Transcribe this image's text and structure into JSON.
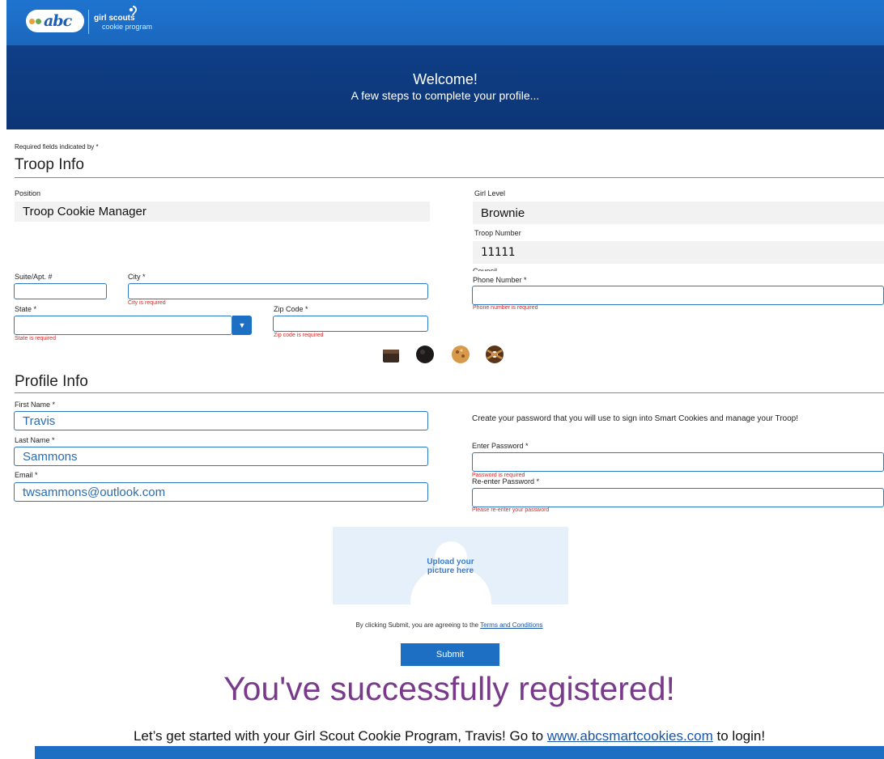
{
  "brand": {
    "abc_logo": "abc",
    "gs_line1": "girl scouts",
    "gs_line2": "cookie program"
  },
  "hero": {
    "title": "Welcome!",
    "subtitle": "A few steps to complete your profile..."
  },
  "required_note": "Required fields indicated by *",
  "troop_info": {
    "title": "Troop Info",
    "position_label": "Position",
    "position_value": "Troop Cookie Manager",
    "girl_level_label": "Girl Level",
    "girl_level_value": "Brownie",
    "troop_number_label": "Troop Number",
    "troop_number_value": "11111",
    "council_label": "Council",
    "suite_label": "Suite/Apt. #",
    "city_label": "City *",
    "city_error": "City is required",
    "state_label": "State *",
    "state_error": "State is required",
    "zip_label": "Zip Code *",
    "zip_error": "Zip code is required",
    "phone_label": "Phone Number *",
    "phone_error": "Phone number is required"
  },
  "profile_info": {
    "title": "Profile Info",
    "first_name_label": "First Name *",
    "first_name_value": "Travis",
    "last_name_label": "Last Name *",
    "last_name_value": "Sammons",
    "email_label": "Email *",
    "email_value": "twsammons@outlook.com",
    "password_intro": "Create your password that you will use to sign into Smart Cookies and manage your Troop!",
    "password_label": "Enter Password *",
    "password_error": "Password is required",
    "reenter_label": "Re-enter Password *",
    "reenter_error": "Please re-enter your password"
  },
  "upload": {
    "line1": "Upload your",
    "line2": "picture here"
  },
  "terms": {
    "prefix": "By clicking Submit, you are agreeing to the ",
    "link": "Terms and Conditions"
  },
  "submit_label": "Submit",
  "success": {
    "headline": "You've successfully registered!",
    "message_prefix": "Let’s get started with your Girl Scout Cookie Program, Travis! Go to ",
    "message_link": "www.abcsmartcookies.com",
    "message_suffix": " to login!"
  },
  "colors": {
    "header_blue": "#1f74cf",
    "hero_navy": "#0f3f87",
    "accent_blue": "#1d6fc4",
    "error_red": "#e02424",
    "success_purple": "#7a3a8c"
  },
  "icons": [
    "abc-logo-icon",
    "girl-scouts-trefoil-icon",
    "select-arrow-icon",
    "cookie-brownie-icon",
    "cookie-thin-mint-icon",
    "cookie-toffee-icon",
    "cookie-samoa-icon",
    "upload-avatar-icon"
  ]
}
